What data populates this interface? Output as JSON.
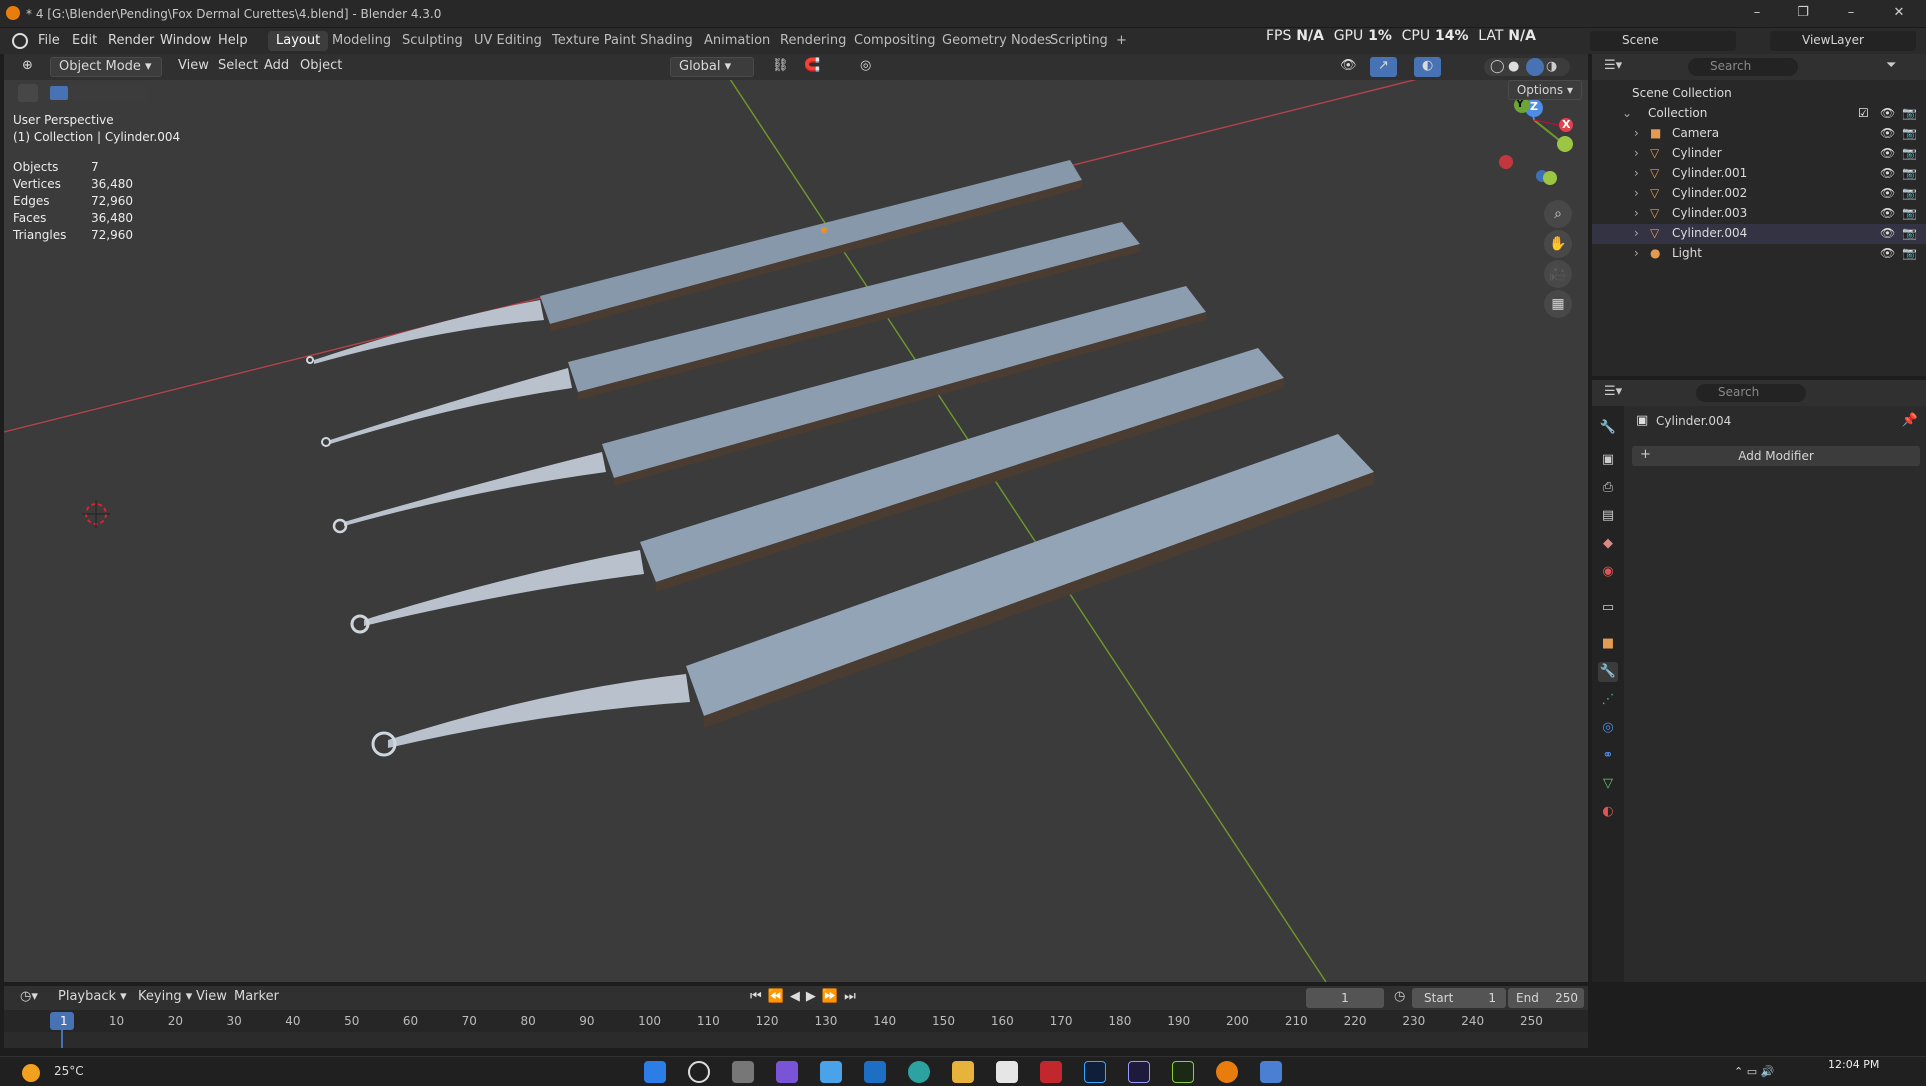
{
  "window": {
    "title": "* 4 [G:\\Blender\\Pending\\Fox Dermal Curettes\\4.blend] - Blender 4.3.0",
    "min": "–",
    "max": "❐",
    "close": "✕"
  },
  "menu": [
    "File",
    "Edit",
    "Render",
    "Window",
    "Help"
  ],
  "workspaces": [
    "Layout",
    "Modeling",
    "Sculpting",
    "UV Editing",
    "Texture Paint",
    "Shading",
    "Animation",
    "Rendering",
    "Compositing",
    "Geometry Nodes",
    "Scripting",
    "+"
  ],
  "active_workspace": "Layout",
  "perf": {
    "fps_label": "FPS",
    "fps": "N/A",
    "gpu_label": "GPU",
    "gpu": "1%",
    "cpu_label": "CPU",
    "cpu": "14%",
    "lat_label": "LAT",
    "lat": "N/A"
  },
  "scene": {
    "scene_name": "Scene",
    "view_layer": "ViewLayer"
  },
  "viewport_header": {
    "mode": "Object Mode",
    "view": "View",
    "select": "Select",
    "add": "Add",
    "object": "Object",
    "orientation": "Global",
    "options": "Options"
  },
  "viewport_info": {
    "line1": "User Perspective",
    "line2": "(1) Collection | Cylinder.004"
  },
  "stats": [
    {
      "k": "Objects",
      "v": "7"
    },
    {
      "k": "Vertices",
      "v": "36,480"
    },
    {
      "k": "Edges",
      "v": "72,960"
    },
    {
      "k": "Faces",
      "v": "36,480"
    },
    {
      "k": "Triangles",
      "v": "72,960"
    }
  ],
  "gizmo": {
    "x": "X",
    "y": "Y",
    "z": "Z"
  },
  "outliner": {
    "search_placeholder": "Search",
    "root": "Scene Collection",
    "collection": "Collection",
    "items": [
      "Camera",
      "Cylinder",
      "Cylinder.001",
      "Cylinder.002",
      "Cylinder.003",
      "Cylinder.004",
      "Light"
    ]
  },
  "properties": {
    "search_placeholder": "Search",
    "object_name": "Cylinder.004",
    "add_modifier": "Add Modifier"
  },
  "timeline": {
    "playback": "Playback",
    "keying": "Keying",
    "view": "View",
    "marker": "Marker",
    "current_frame": "1",
    "start_label": "Start",
    "start": "1",
    "end_label": "End",
    "end": "250",
    "ticks": [
      "1",
      "10",
      "20",
      "30",
      "40",
      "50",
      "60",
      "70",
      "80",
      "90",
      "100",
      "110",
      "120",
      "130",
      "140",
      "150",
      "160",
      "170",
      "180",
      "190",
      "200",
      "210",
      "220",
      "230",
      "240",
      "250"
    ]
  },
  "taskbar": {
    "weather": "25°C",
    "time": "12:04 PM"
  }
}
